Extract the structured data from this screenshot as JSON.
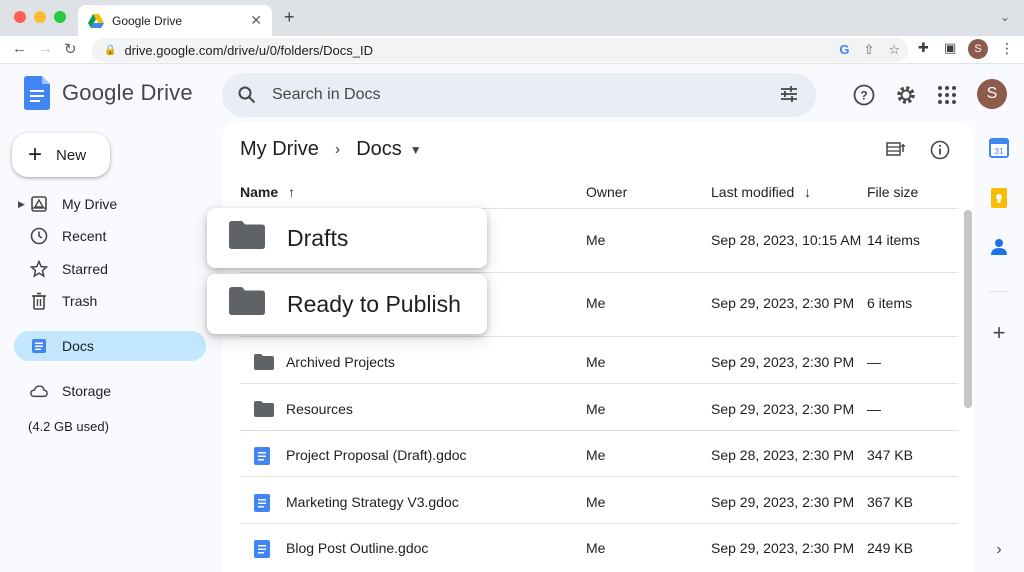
{
  "browser": {
    "tab_title": "Google Drive",
    "tab_close": "✕",
    "new_tab": "+",
    "url": "drive.google.com/drive/u/0/folders/Docs_ID",
    "profile_initial": "S"
  },
  "header": {
    "logo_text": "Google Drive",
    "search_placeholder": "Search in Docs",
    "avatar_initial": "S"
  },
  "sidebar": {
    "new_label": "New",
    "items": [
      {
        "label": "My Drive",
        "icon": "my-drive-icon"
      },
      {
        "label": "Recent",
        "icon": "clock-icon"
      },
      {
        "label": "Starred",
        "icon": "star-icon"
      },
      {
        "label": "Trash",
        "icon": "trash-icon"
      },
      {
        "label": "Docs",
        "icon": "docs-icon"
      },
      {
        "label": "Storage",
        "icon": "cloud-icon"
      }
    ],
    "storage_used": "(4.2 GB used)"
  },
  "breadcrumb": {
    "root": "My Drive",
    "current": "Docs"
  },
  "columns": {
    "name": "Name",
    "owner": "Owner",
    "last_modified": "Last modified",
    "file_size": "File size"
  },
  "files": [
    {
      "name": "Drafts",
      "type": "folder",
      "owner": "Me",
      "modified": "Sep 28, 2023, 10:15 AM",
      "size": "14 items"
    },
    {
      "name": "Ready to Publish",
      "type": "folder",
      "owner": "Me",
      "modified": "Sep 29, 2023, 2:30 PM",
      "size": "6 items"
    },
    {
      "name": "Archived Projects",
      "type": "folder",
      "owner": "Me",
      "modified": "Sep 29, 2023, 2:30 PM",
      "size": "—"
    },
    {
      "name": "Resources",
      "type": "folder",
      "owner": "Me",
      "modified": "Sep 29, 2023, 2:30 PM",
      "size": "—"
    },
    {
      "name": "Project Proposal (Draft).gdoc",
      "type": "doc",
      "owner": "Me",
      "modified": "Sep 28, 2023, 2:30 PM",
      "size": "347 KB"
    },
    {
      "name": "Marketing Strategy V3.gdoc",
      "type": "doc",
      "owner": "Me",
      "modified": "Sep 29, 2023, 2:30 PM",
      "size": "367 KB"
    },
    {
      "name": "Blog Post Outline.gdoc",
      "type": "doc",
      "owner": "Me",
      "modified": "Sep 29, 2023, 2:30 PM",
      "size": "249 KB"
    }
  ],
  "rail": {
    "calendar_day": "31"
  },
  "colors": {
    "active_nav": "#c2e7ff",
    "folder": "#5f6368",
    "doc_blue": "#4285f4"
  }
}
